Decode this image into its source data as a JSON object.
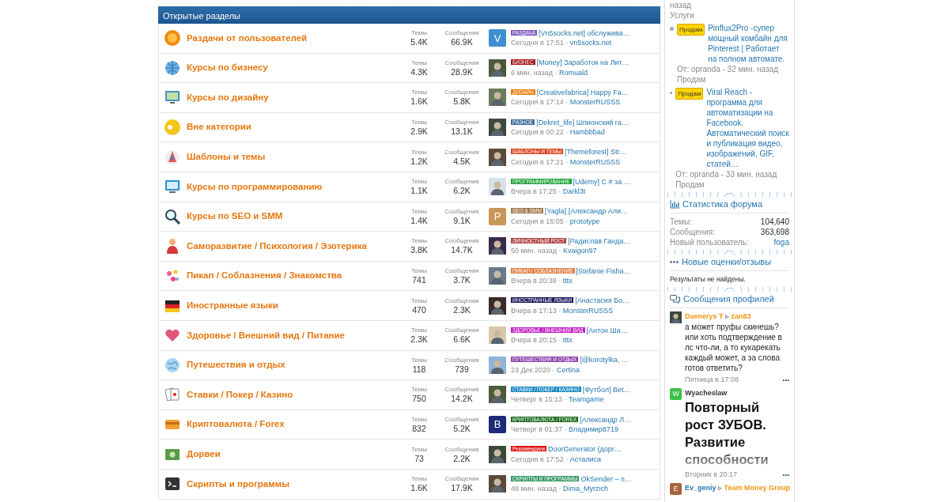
{
  "section": {
    "title": "Открытые разделы"
  },
  "forums": [
    {
      "title": "Раздачи от пользователей",
      "topics_label": "Темы",
      "topics": "5.4K",
      "posts_label": "Сообщения",
      "posts": "66.9K",
      "avatar": {
        "kind": "letter",
        "letter": "V",
        "color": "#3d8fd1"
      },
      "tag": {
        "label": "РАЗДАЧА",
        "color": "#7e57c2"
      },
      "thread": "[Vn5socks.net] обслужива…",
      "time": "Сегодня в 17:51 ·",
      "author": "vn5socks.net"
    },
    {
      "title": "Курсы по бизнесу",
      "topics_label": "Темы",
      "topics": "4.3K",
      "posts_label": "Сообщения",
      "posts": "28.9K",
      "tag": {
        "label": "БИЗНЕС",
        "color": "#a31515"
      },
      "thread": "[Money] Заработок на Лит…",
      "time": "6 мин. назад ·",
      "author": "Romuald"
    },
    {
      "title": "Курсы по дизайну",
      "topics_label": "Темы",
      "topics": "1.6K",
      "posts_label": "Сообщения",
      "posts": "5.8K",
      "tag": {
        "label": "ДИЗАЙН",
        "color": "#e67e00"
      },
      "thread": "[Creativefabrica] Happy Fa…",
      "time": "Сегодня в 17:14 ·",
      "author": "MonsterRUSSS"
    },
    {
      "title": "Вне категории",
      "topics_label": "Темы",
      "topics": "2.9K",
      "posts_label": "Сообщения",
      "posts": "13.1K",
      "tag": {
        "label": "РАЗНОЕ",
        "color": "#3d6b99"
      },
      "thread": "[Dekret_life] Шпионский га…",
      "time": "Сегодня в 00:22 ·",
      "author": "Hambbbad"
    },
    {
      "title": "Шаблоны и темы",
      "topics_label": "Темы",
      "topics": "1.2K",
      "posts_label": "Сообщения",
      "posts": "4.5K",
      "tag": {
        "label": "ШАБЛОНЫ И ТЕМЫ",
        "color": "#d9431c"
      },
      "thread": "[Themeforest] Str…",
      "time": "Сегодня в 17:21 ·",
      "author": "MonsterRUSSS"
    },
    {
      "title": "Курсы по программированию",
      "topics_label": "Темы",
      "topics": "1.1K",
      "posts_label": "Сообщения",
      "posts": "6.2K",
      "tag": {
        "label": "ПРОГРАММИРОВАНИЕ",
        "color": "#22a33a"
      },
      "thread": "[Udemy] C # за …",
      "time": "Вчера в 17:25 ·",
      "author": "Darkl3t"
    },
    {
      "title": "Курсы по SEO и SMM",
      "topics_label": "Темы",
      "topics": "1.4K",
      "posts_label": "Сообщения",
      "posts": "9.1K",
      "avatar": {
        "kind": "letter",
        "letter": "P",
        "color": "#c9965a"
      },
      "tag": {
        "label": "SEO & SMM",
        "color": "#a07a4a"
      },
      "thread": "[Yagla] [Александр Али…",
      "time": "Сегодня в 16:05 ·",
      "author": "prototype"
    },
    {
      "title": "Саморазвитие / Психология / Эзотерика",
      "topics_label": "Темы",
      "topics": "3.8K",
      "posts_label": "Сообщения",
      "posts": "14.7K",
      "tag": {
        "label": "ЛИЧНОСТНЫЙ РОСТ",
        "color": "#b04545"
      },
      "thread": "[Радислав Ганда…",
      "time": "50 мин. назад ·",
      "author": "Kvaigon97"
    },
    {
      "title": "Пикап / Соблазнения / Знакомства",
      "topics_label": "Темы",
      "topics": "741",
      "posts_label": "Сообщения",
      "posts": "3.7K",
      "tag": {
        "label": "ПИКАП / СОБЛАЗНЕНИЕ",
        "color": "#e0804a"
      },
      "thread": "[Stefanie Fisha…",
      "time": "Вчера в 20:38 ·",
      "author": "tttx"
    },
    {
      "title": "Иностранные языки",
      "topics_label": "Темы",
      "topics": "470",
      "posts_label": "Сообщения",
      "posts": "2.3K",
      "tag": {
        "label": "ИНОСТРАННЫЕ ЯЗЫКИ",
        "color": "#1a1a5e"
      },
      "thread": "[Анастасия Бо…",
      "time": "Вчера в 17:13 ·",
      "author": "MonsterRUSSS"
    },
    {
      "title": "Здоровье / Внешний вид / Питание",
      "topics_label": "Темы",
      "topics": "2.3K",
      "posts_label": "Сообщения",
      "posts": "6.6K",
      "tag": {
        "label": "ЗДОРОВЬЕ / ВНЕШНИЙ ВИД",
        "color": "#c21fc2"
      },
      "thread": "[Антон Ша…",
      "time": "Вчера в 20:15 ·",
      "author": "tttx"
    },
    {
      "title": "Путешествия и отдых",
      "topics_label": "Темы",
      "topics": "118",
      "posts_label": "Сообщения",
      "posts": "739",
      "tag": {
        "label": "ПУТЕШЕСТВИЯ И ОТДЫХ",
        "color": "#8e44ad"
      },
      "thread": "[@korotylka, …",
      "time": "23 Дек 2020 ·",
      "author": "Certina"
    },
    {
      "title": "Ставки / Покер / Казино",
      "topics_label": "Темы",
      "topics": "750",
      "posts_label": "Сообщения",
      "posts": "14.2K",
      "tag": {
        "label": "СТАВКИ / ПОКЕР / КАЗИНО",
        "color": "#1b8ac2"
      },
      "thread": "[Футбол] Bet…",
      "time": "Четверг в 15:13 ·",
      "author": "Teamgame"
    },
    {
      "title": "Криптовалюта / Forex",
      "topics_label": "Темы",
      "topics": "832",
      "posts_label": "Сообщения",
      "posts": "5.2K",
      "avatar": {
        "kind": "letter",
        "letter": "B",
        "color": "#1c2a7a"
      },
      "tag": {
        "label": "КРИПТОВАЛЮТА / FOREX",
        "color": "#1e6b1e"
      },
      "thread": "[Александр Л…",
      "time": "Четверг в 01:37 ·",
      "author": "Владимир8719"
    },
    {
      "title": "Дорвеи",
      "topics_label": "Темы",
      "topics": "73",
      "posts_label": "Сообщения",
      "posts": "2.2K",
      "tag": {
        "label": "Рекомендуем",
        "color": "#e01010"
      },
      "thread": "DoorGenerator (дорг…",
      "time": "Сегодня в 17:52 ·",
      "author": "Асталиса"
    },
    {
      "title": "Скрипты и программы",
      "topics_label": "Темы",
      "topics": "1.6K",
      "posts_label": "Сообщения",
      "posts": "17.9K",
      "tag": {
        "label": "СКРИПТЫ И ПРОГРАММЫ",
        "color": "#3a9a6a"
      },
      "thread": "OkSender – п…",
      "time": "48 мин. назад ·",
      "author": "Dima_Myrzich"
    }
  ],
  "market": {
    "top_time": "назад",
    "top_category": "Услуги",
    "items": [
      {
        "badge": "Продам",
        "title": "Pinflux2Pro -супер мощный комбайн для Pinterest | Работает на полном автомате.",
        "meta": "От: opranda - 32 мин. назад",
        "category": "Продам"
      },
      {
        "badge": "Продам",
        "title": "Viral Reach - программа для автоматизации на Facebook. Автоматический поиск и публикация видео, изображений, GIF, статей…",
        "meta": "От: opranda - 33 мин. назад",
        "category": "Продам"
      }
    ]
  },
  "stats": {
    "title": "Статистика форума",
    "rows": [
      {
        "label": "Темы:",
        "value": "104,640",
        "kind": "plain"
      },
      {
        "label": "Сообщения:",
        "value": "363,698",
        "kind": "plain"
      },
      {
        "label": "Новый пользователь:",
        "value": "foga",
        "kind": "link"
      }
    ]
  },
  "reviews": {
    "title": "Новые оценки/отзывы",
    "empty": "Результаты не найдены."
  },
  "profile_posts": {
    "title": "Сообщения профилей",
    "items": [
      {
        "kind": "text",
        "author": {
          "name": "Daenerys T",
          "color": "#f0960e"
        },
        "arrow": "▹",
        "target": "zan83",
        "text": "а может пруфы скинешь? или хоть подтверждение в лс что-ли, а то кукарекать каждый может, а за слова готов ответить?",
        "time": "Пятница в 17:08",
        "menu": "•••"
      },
      {
        "kind": "headline",
        "avatar": {
          "kind": "letter",
          "letter": "W",
          "color": "#3cc24a"
        },
        "author": {
          "name": "Wyacheslaw",
          "color": "#333333"
        },
        "text": "Повторный рост ЗУБОВ. Развитие способности",
        "time": "Вторник в 20:17",
        "menu": "•••"
      },
      {
        "kind": "header",
        "avatar": {
          "kind": "letter",
          "letter": "E",
          "color": "#a8643a"
        },
        "author": {
          "name": "Ev_geniy",
          "color": "#2577b1"
        },
        "arrow": "▹",
        "target": "Team Money Group"
      }
    ]
  }
}
